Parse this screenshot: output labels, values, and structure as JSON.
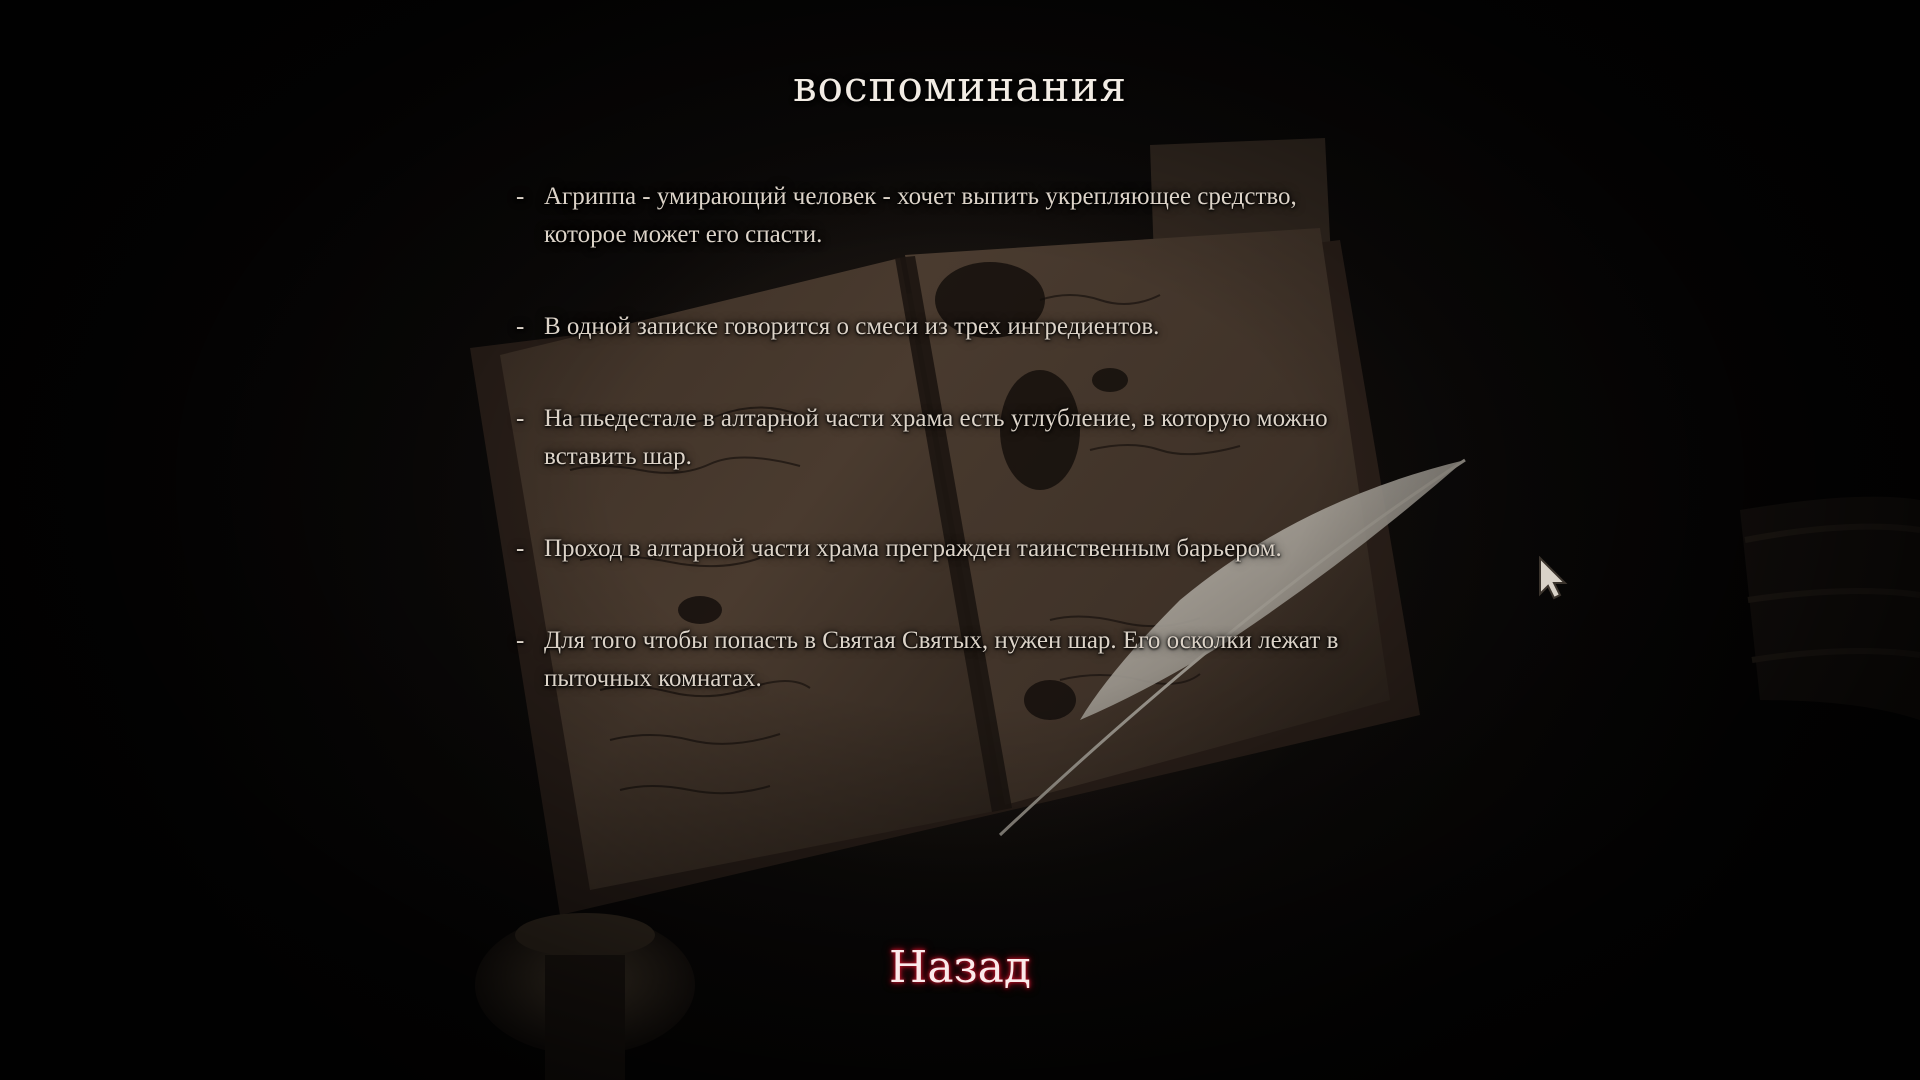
{
  "screen": {
    "title": "воспоминания",
    "memories": [
      "Агриппа - умирающий человек - хочет выпить укрепляющее средство, которое может его спасти.",
      "В одной записке говорится о смеси из трех ингредиентов.",
      "На пьедестале в алтарной части храма есть углубление, в которую можно вставить шар.",
      "Проход в алтарной части храма прегражден таинственным барьером.",
      "Для того чтобы попасть в Святая Святых, нужен шар. Его осколки лежат в пыточных комнатах."
    ],
    "bullet": "-",
    "back_label": "Назад"
  },
  "colors": {
    "title": "#f2ece4",
    "text": "#dcd3c8",
    "back_glow": "#c0142a",
    "background": "#080605"
  },
  "icons": {
    "cursor": "cursor-arrow-icon"
  }
}
